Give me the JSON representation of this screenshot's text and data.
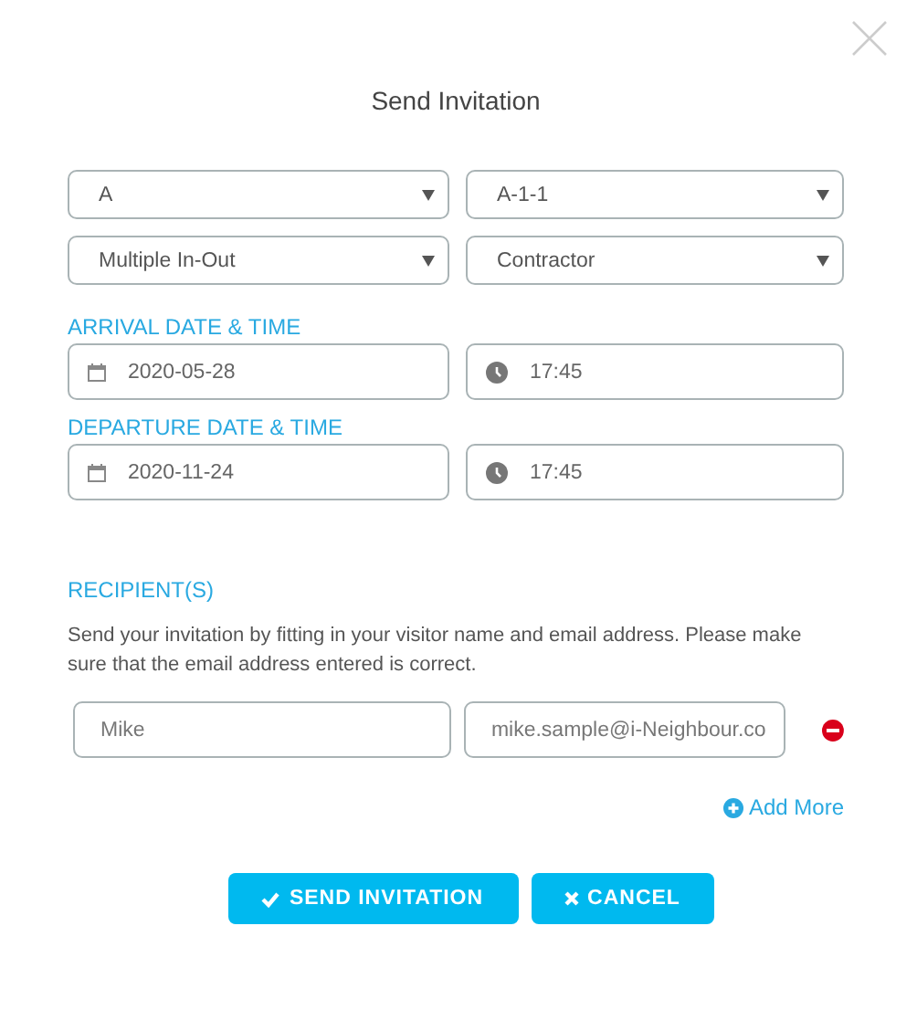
{
  "title": "Send Invitation",
  "selects": [
    {
      "value": "A"
    },
    {
      "value": "A-1-1"
    },
    {
      "value": "Multiple In-Out"
    },
    {
      "value": "Contractor"
    }
  ],
  "arrival": {
    "label": "ARRIVAL DATE & TIME",
    "date": "2020-05-28",
    "time": "17:45"
  },
  "departure": {
    "label": "DEPARTURE DATE & TIME",
    "date": "2020-11-24",
    "time": "17:45"
  },
  "recipients": {
    "label": "RECIPIENT(S)",
    "note": "Send your invitation by fitting in your visitor name and email address. Please make sure that the email address entered is correct.",
    "rows": [
      {
        "name": "Mike",
        "email": "mike.sample@i-Neighbour.co"
      }
    ],
    "add_more": "Add More"
  },
  "buttons": [
    {
      "kind": "send",
      "label": "SEND INVITATION"
    },
    {
      "kind": "cancel",
      "label": "CANCEL"
    }
  ]
}
